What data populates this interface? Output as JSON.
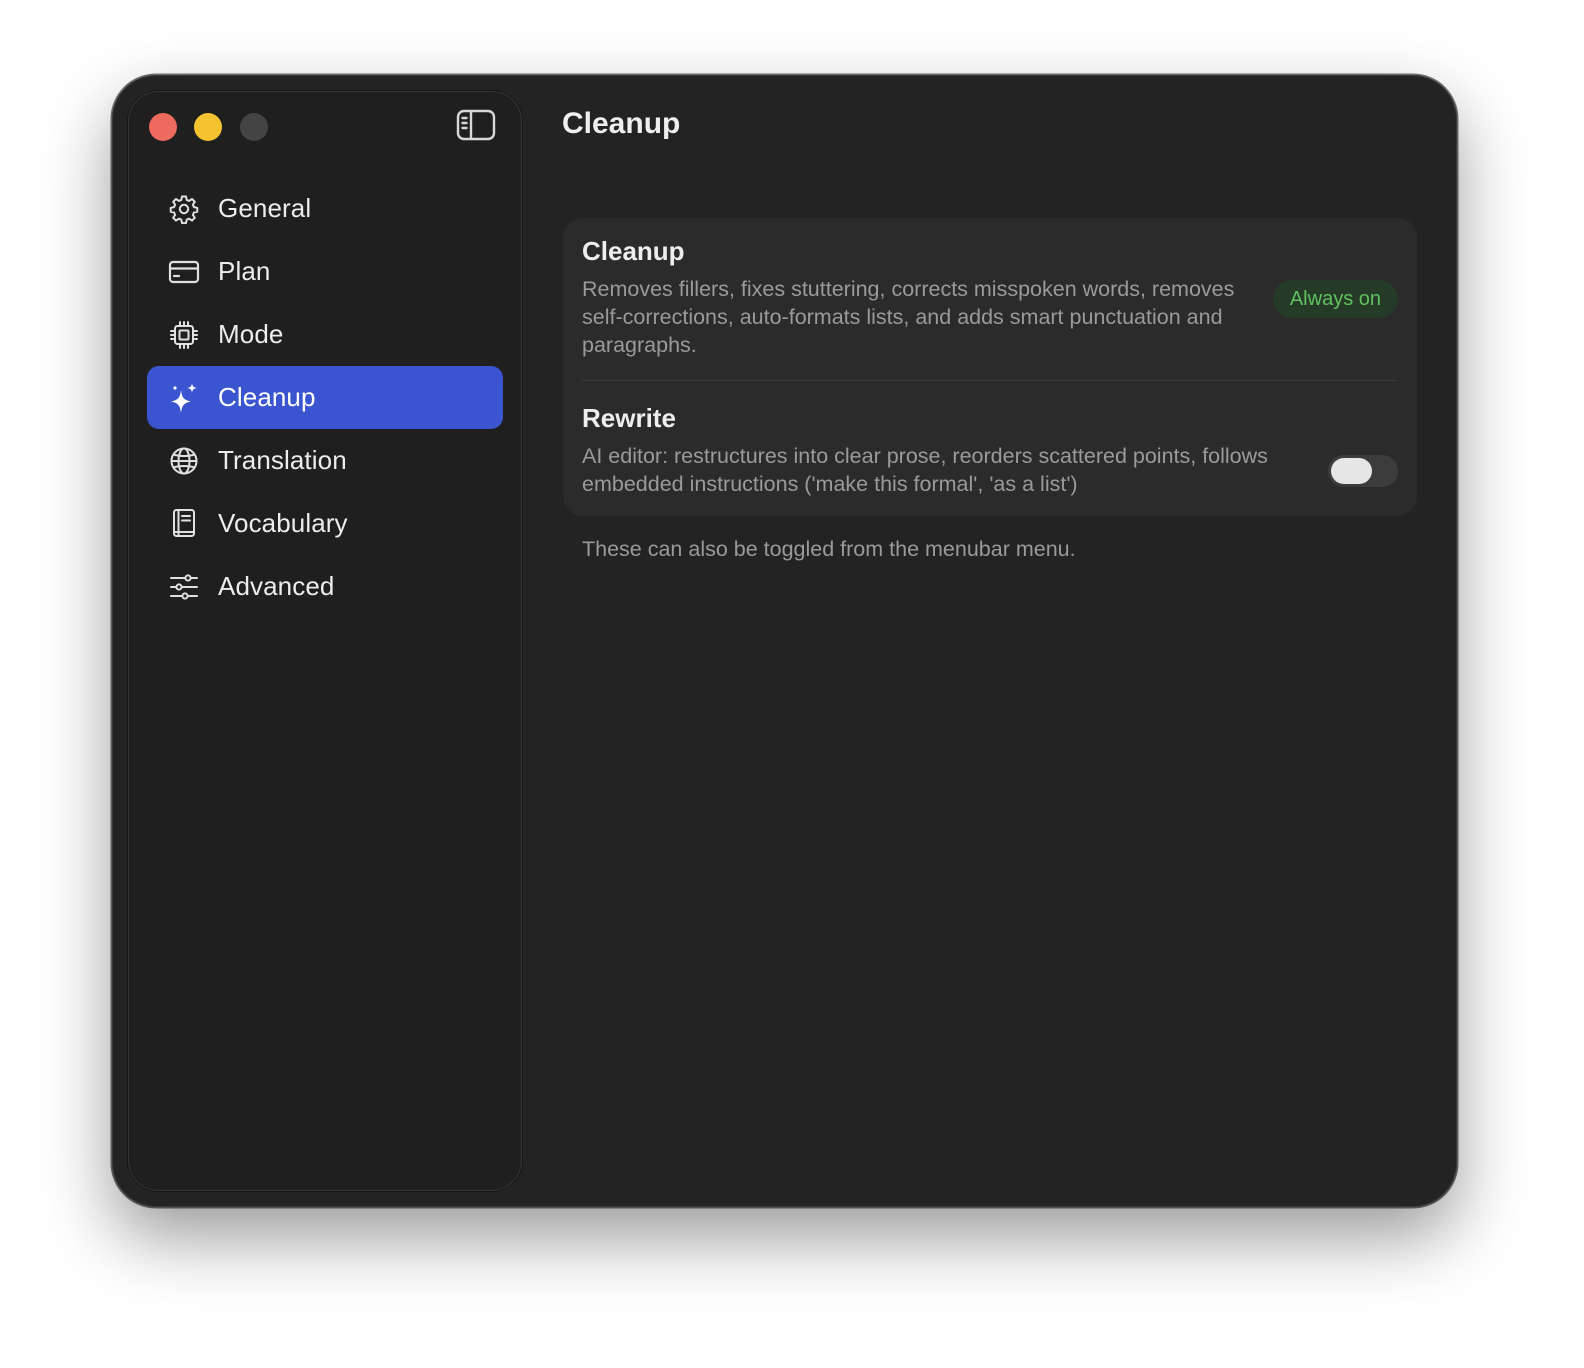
{
  "window": {
    "traffic_lights": [
      "close",
      "minimize",
      "zoom"
    ]
  },
  "sidebar": {
    "toggle_icon": "sidebar-left-icon",
    "items": [
      {
        "label": "General",
        "icon": "gear-icon"
      },
      {
        "label": "Plan",
        "icon": "credit-card-icon"
      },
      {
        "label": "Mode",
        "icon": "cpu-chip-icon"
      },
      {
        "label": "Cleanup",
        "icon": "sparkles-icon",
        "active": true
      },
      {
        "label": "Translation",
        "icon": "globe-icon"
      },
      {
        "label": "Vocabulary",
        "icon": "book-icon"
      },
      {
        "label": "Advanced",
        "icon": "sliders-icon"
      }
    ],
    "active_color": "#3a55cf"
  },
  "main": {
    "title": "Cleanup",
    "settings": [
      {
        "title": "Cleanup",
        "description": "Removes fillers, fixes stuttering, corrects misspoken words, removes self-corrections, auto-formats lists, and adds smart punctuation and paragraphs.",
        "badge": "Always on",
        "badge_color": "#5fc25f"
      },
      {
        "title": "Rewrite",
        "description": "AI editor: restructures into clear prose, reorders scattered points, follows embedded instructions ('make this formal', 'as a list')",
        "toggle_on": false
      }
    ],
    "footnote": "These can also be toggled from the menubar menu."
  }
}
